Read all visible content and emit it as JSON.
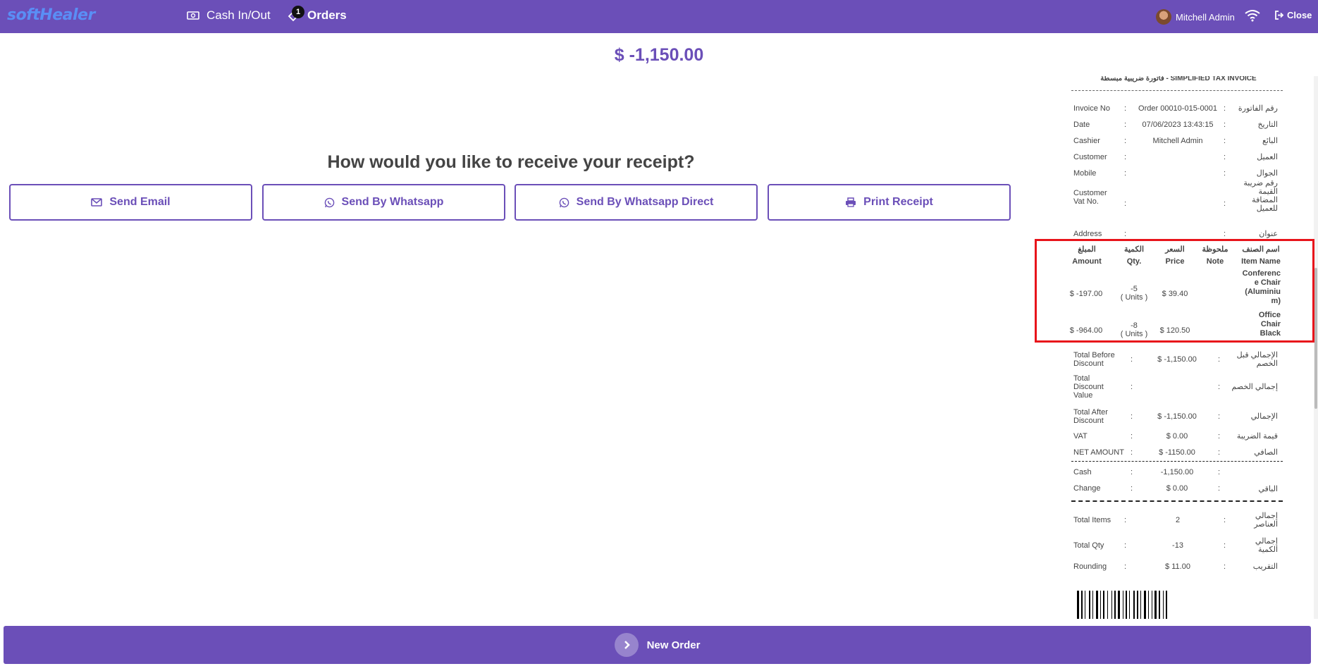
{
  "header": {
    "logo": "softHealer",
    "nav_cash": "Cash In/Out",
    "nav_orders": "Orders",
    "orders_badge": "1",
    "user_name": "Mitchell Admin",
    "close_label": "Close"
  },
  "main": {
    "amount": "$ -1,150.00",
    "question": "How would you like to receive your receipt?",
    "buttons": {
      "email": "Send Email",
      "whatsapp": "Send By Whatsapp",
      "whatsapp_direct": "Send By Whatsapp Direct",
      "print": "Print Receipt"
    },
    "new_order": "New Order"
  },
  "receipt": {
    "title": "فاتورة ضريبية مبسطة - SIMPLIFIED TAX INVOICE",
    "info": [
      {
        "en": "Invoice No",
        "val": "Order 00010-015-0001",
        "ar": "رقم الفاتورة"
      },
      {
        "en": "Date",
        "val": "07/06/2023 13:43:15",
        "ar": "التاريخ"
      },
      {
        "en": "Cashier",
        "val": "Mitchell Admin",
        "ar": "البائع"
      },
      {
        "en": "Customer",
        "val": "",
        "ar": "العميل"
      },
      {
        "en": "Mobile",
        "val": "",
        "ar": "الجوال"
      },
      {
        "en": "Customer\nVat No.",
        "val": "",
        "ar": "رقم ضريبة\nالقيمة\nالمضافة\nللعميل"
      },
      {
        "en": "Address",
        "val": "",
        "ar": "عنوان"
      }
    ],
    "columns": [
      {
        "ar": "المبلغ",
        "en": "Amount"
      },
      {
        "ar": "الكمية",
        "en": "Qty."
      },
      {
        "ar": "السعر",
        "en": "Price"
      },
      {
        "ar": "ملحوظة",
        "en": "Note"
      },
      {
        "ar": "اسم الصنف",
        "en": "Item Name"
      }
    ],
    "lines": [
      {
        "amount": "$ -197.00",
        "qty": "-5",
        "unit": "( Units )",
        "price": "$ 39.40",
        "note": "",
        "name": "Conferenc\ne Chair\n(Aluminiu\nm)"
      },
      {
        "amount": "$ -964.00",
        "qty": "-8",
        "unit": "( Units )",
        "price": "$ 120.50",
        "note": "",
        "name": "Office\nChair\nBlack"
      }
    ],
    "totals": [
      {
        "en": "Total Before\nDiscount",
        "val": "$ -1,150.00",
        "ar": "الإجمالي قبل\nالخصم"
      },
      {
        "en": "Total\nDiscount\nValue",
        "val": "",
        "ar": "إجمالي الخصم"
      },
      {
        "en": "Total After\nDiscount",
        "val": "$ -1,150.00",
        "ar": "الإجمالي"
      },
      {
        "en": "VAT",
        "val": "$ 0.00",
        "ar": "قيمة الضريبة"
      },
      {
        "en": "NET AMOUNT",
        "val": "$ -1150.00",
        "ar": "الصافي"
      }
    ],
    "payments": [
      {
        "en": "Cash",
        "val": "-1,150.00",
        "ar": ""
      },
      {
        "en": "Change",
        "val": "$ 0.00",
        "ar": "الباقي"
      }
    ],
    "summary": [
      {
        "en": "Total Items",
        "val": "2",
        "ar": "إجمالي\nالعناصر"
      },
      {
        "en": "Total Qty",
        "val": "-13",
        "ar": "إجمالي\nالكمية"
      },
      {
        "en": "Rounding",
        "val": "$ 11.00",
        "ar": "التقريب"
      }
    ]
  },
  "colors": {
    "accent": "#6b4fb8",
    "highlight": "#e8141b"
  }
}
